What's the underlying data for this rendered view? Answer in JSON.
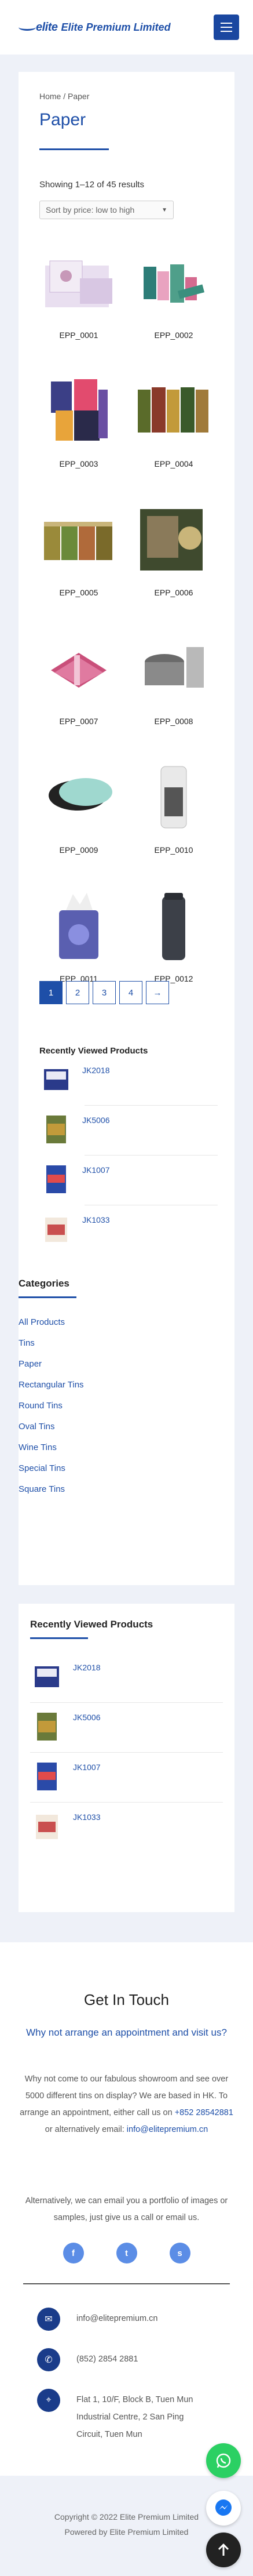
{
  "header": {
    "logo_mark": "elite",
    "logo_text": "Elite Premium Limited",
    "menu_icon": "hamburger-icon"
  },
  "breadcrumb": "Home / Paper",
  "page_title": "Paper",
  "results_text": "Showing 1–12 of 45 results",
  "sort_value": "Sort by price: low to high",
  "products": [
    {
      "name": "EPP_0001"
    },
    {
      "name": "EPP_0002"
    },
    {
      "name": "EPP_0003"
    },
    {
      "name": "EPP_0004"
    },
    {
      "name": "EPP_0005"
    },
    {
      "name": "EPP_0006"
    },
    {
      "name": "EPP_0007"
    },
    {
      "name": "EPP_0008"
    },
    {
      "name": "EPP_0009"
    },
    {
      "name": "EPP_0010"
    },
    {
      "name": "EPP_0011"
    },
    {
      "name": "EPP_0012"
    }
  ],
  "pagination": {
    "pages": [
      "1",
      "2",
      "3",
      "4"
    ],
    "current": "1",
    "next": "→"
  },
  "recently_viewed_inline": {
    "title": "Recently Viewed Products",
    "items": [
      "JK2018",
      "JK5006",
      "JK1007",
      "JK1033"
    ]
  },
  "categories": {
    "title": "Categories",
    "items": [
      "All Products",
      "Tins",
      "Paper",
      "Rectangular Tins",
      "Round Tins",
      "Oval Tins",
      "Wine Tins",
      "Special Tins",
      "Square Tins"
    ]
  },
  "recently_viewed_widget": {
    "title": "Recently Viewed Products",
    "items": [
      "JK2018",
      "JK5006",
      "JK1007",
      "JK1033"
    ]
  },
  "get_in_touch": {
    "title": "Get In Touch",
    "subtitle": "Why not arrange an appointment and visit us?",
    "body": "Why not come to our fabulous showroom and see over 5000 different tins on display? We are based in HK. To arrange an appointment, either call us on",
    "phone_link": "+852 28542881",
    "or_text": "or alternatively email:",
    "email_link": "info@elitepremium.cn",
    "body2": "Alternatively, we can email you a portfolio of images or samples, just give us a call or email us.",
    "social": [
      "facebook-icon",
      "twitter-icon",
      "skype-icon"
    ]
  },
  "contact": {
    "email": "info@elitepremium.cn",
    "phone": "(852) 2854 2881",
    "address": "Flat 1, 10/F, Block B, Tuen Mun Industrial Centre, 2 San Ping Circuit, Tuen Mun"
  },
  "copyright": "Copyright © 2022 Elite Premium Limited",
  "powered_by": "Powered by Elite Premium Limited",
  "colors": {
    "brand_blue": "#1e4fa8",
    "whatsapp_green": "#2bd063",
    "page_bg": "#eef1f8"
  }
}
